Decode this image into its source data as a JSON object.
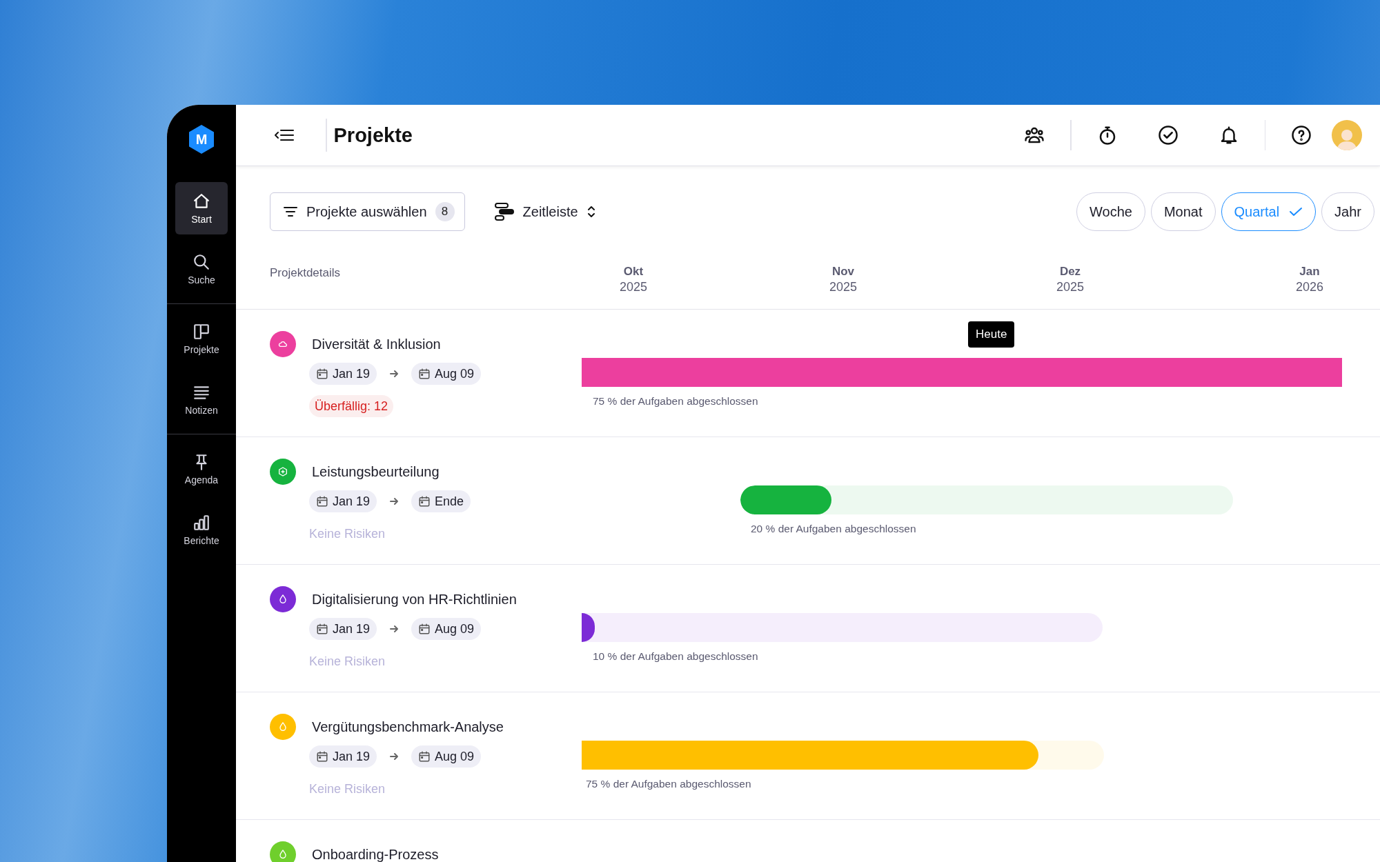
{
  "sidebar": {
    "logo": {
      "letter": "M"
    },
    "groups": [
      {
        "items": [
          {
            "label": "Start",
            "kind": "home",
            "selected": true
          },
          {
            "label": "Suche",
            "kind": "search",
            "selected": false
          }
        ]
      },
      {
        "items": [
          {
            "label": "Projekte",
            "kind": "board",
            "selected": false
          },
          {
            "label": "Notizen",
            "kind": "lines",
            "selected": false
          }
        ]
      },
      {
        "items": [
          {
            "label": "Agenda",
            "kind": "pin",
            "selected": false
          },
          {
            "label": "Berichte",
            "kind": "chart",
            "selected": false
          }
        ]
      }
    ]
  },
  "header": {
    "title": "Projekte",
    "icons": [
      {
        "kind": "people"
      },
      {
        "kind": "separator"
      },
      {
        "kind": "timer"
      },
      {
        "kind": "check"
      },
      {
        "kind": "bell"
      },
      {
        "kind": "separator"
      },
      {
        "kind": "help"
      },
      {
        "kind": "avatar"
      }
    ]
  },
  "toolbar": {
    "filter": {
      "label": "Projekte auswählen",
      "count": "8"
    },
    "view": {
      "label": "Zeitleiste"
    },
    "ranges": [
      {
        "label": "Woche",
        "selected": false
      },
      {
        "label": "Monat",
        "selected": false
      },
      {
        "label": "Quartal",
        "selected": true
      },
      {
        "label": "Jahr",
        "selected": false
      }
    ]
  },
  "columns": {
    "details_label": "Projektdetails",
    "months": [
      {
        "month": "Okt",
        "year": "2025"
      },
      {
        "month": "Nov",
        "year": "2025"
      },
      {
        "month": "Dez",
        "year": "2025"
      },
      {
        "month": "Jan",
        "year": "2026"
      }
    ]
  },
  "today": {
    "label": "Heute"
  },
  "rows": [
    {
      "title": "Diversität & Inklusion",
      "color": "#ec3f9e",
      "kind": "cloud",
      "start": "Jan 19",
      "end": "Aug 09",
      "risk": {
        "kind": "overdue",
        "label": "Überfällig: 12"
      },
      "progress": {
        "level": 1,
        "label": "75 % der Aufgaben abgeschlossen"
      }
    },
    {
      "title": "Leistungsbeurteilung",
      "color": "#16b33f",
      "kind": "plus",
      "start": "Jan 19",
      "end": "Ende",
      "risk": {
        "kind": "none",
        "label": "Keine Risiken"
      },
      "progress": {
        "level": 0.185,
        "label": "20 % der Aufgaben abgeschlossen"
      }
    },
    {
      "title": "Digitalisierung von HR-Richtlinien",
      "color": "#7c2bd6",
      "kind": "drop",
      "start": "Jan 19",
      "end": "Aug 09",
      "risk": {
        "kind": "none",
        "label": "Keine Risiken"
      },
      "progress": {
        "level": 0.025,
        "label": "10 % der Aufgaben abgeschlossen"
      }
    },
    {
      "title": "Vergütungsbenchmark-Analyse",
      "color": "#ffbf00",
      "kind": "drop",
      "start": "Jan 19",
      "end": "Aug 09",
      "risk": {
        "kind": "none",
        "label": "Keine Risiken"
      },
      "progress": {
        "level": 0.875,
        "label": "75 % der Aufgaben abgeschlossen"
      }
    },
    {
      "title": "Onboarding-Prozess",
      "color": "#6fcf2c",
      "kind": "drop"
    }
  ]
}
